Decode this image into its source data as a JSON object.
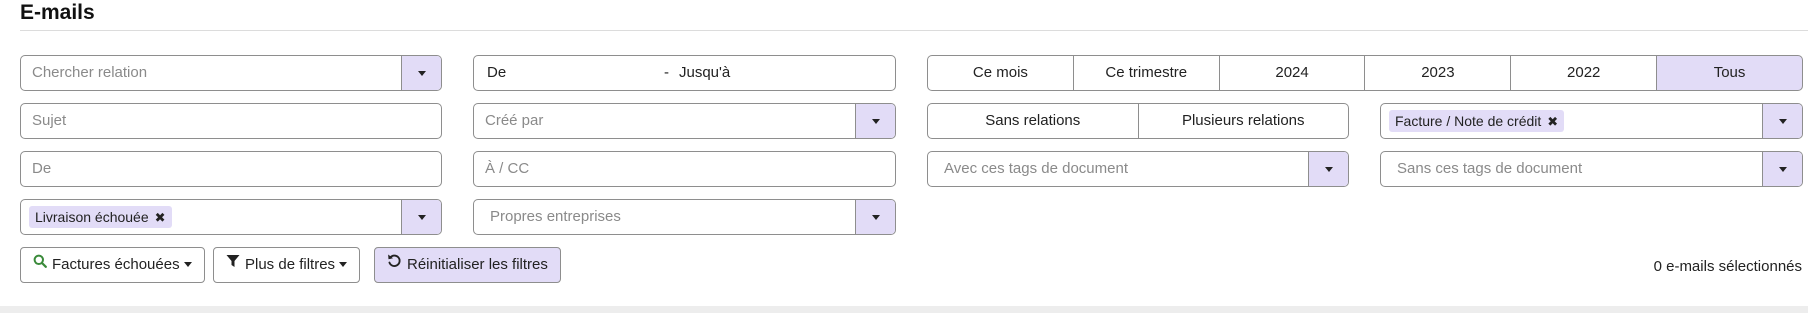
{
  "page": {
    "title": "E-mails"
  },
  "filters": {
    "relation": {
      "placeholder": "Chercher relation"
    },
    "date_from": {
      "label": "De"
    },
    "date_sep": "-",
    "date_to": {
      "label": "Jusqu'à"
    },
    "periods": [
      "Ce mois",
      "Ce trimestre",
      "2024",
      "2023",
      "2022",
      "Tous"
    ],
    "period_active": "Tous",
    "subject": {
      "placeholder": "Sujet"
    },
    "created_by": {
      "placeholder": "Créé par"
    },
    "relation_modes": [
      "Sans relations",
      "Plusieurs relations"
    ],
    "doc_type": {
      "tag": "Facture / Note de crédit"
    },
    "sender": {
      "placeholder": "De"
    },
    "recipient": {
      "placeholder": "À / CC"
    },
    "with_tags": {
      "placeholder": "Avec ces tags de document"
    },
    "without_tags": {
      "placeholder": "Sans ces tags de document"
    },
    "status": {
      "tag": "Livraison échouée"
    },
    "companies": {
      "placeholder": "Propres entreprises"
    }
  },
  "toolbar": {
    "saved_search_label": "Factures échouées",
    "more_filters_label": "Plus de filtres",
    "reset_label": "Réinitialiser les filtres"
  },
  "summary": {
    "selected_text": "0 e-mails sélectionnés"
  },
  "icons": {
    "search": "search-icon",
    "filter": "funnel-icon",
    "reset": "undo-icon",
    "remove": "close-icon",
    "dropdown": "chevron-down-icon"
  },
  "colors": {
    "accent": "#e2dcf7",
    "border": "#8e8e8e",
    "search_icon": "#3a8a3a"
  }
}
